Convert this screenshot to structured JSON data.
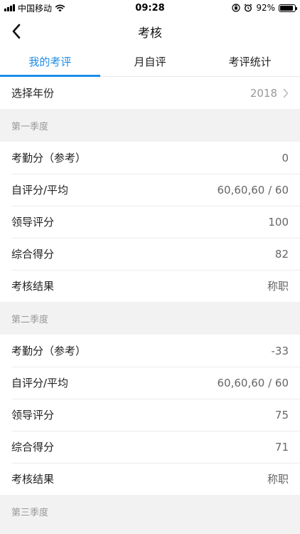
{
  "status_bar": {
    "carrier": "中国移动",
    "time": "09:28",
    "battery": "92%",
    "battery_level": 0.92,
    "icons": [
      "signal-icon",
      "wifi-icon",
      "orientation-lock-icon",
      "alarm-icon",
      "battery-icon"
    ]
  },
  "nav": {
    "title": "考核",
    "back_icon": "chevron-left-icon"
  },
  "tabs": [
    {
      "label": "我的考评",
      "active": true
    },
    {
      "label": "月自评",
      "active": false
    },
    {
      "label": "考评统计",
      "active": false
    }
  ],
  "year_selector": {
    "label": "选择年份",
    "value": "2018",
    "icon": "chevron-right-icon"
  },
  "sections": [
    {
      "title": "第一季度",
      "rows": [
        {
          "label": "考勤分（参考）",
          "value": "0"
        },
        {
          "label": "自评分/平均",
          "value": "60,60,60 / 60"
        },
        {
          "label": "领导评分",
          "value": "100"
        },
        {
          "label": "综合得分",
          "value": "82"
        },
        {
          "label": "考核结果",
          "value": "称职"
        }
      ]
    },
    {
      "title": "第二季度",
      "rows": [
        {
          "label": "考勤分（参考）",
          "value": "-33"
        },
        {
          "label": "自评分/平均",
          "value": "60,60,60 / 60"
        },
        {
          "label": "领导评分",
          "value": "75"
        },
        {
          "label": "综合得分",
          "value": "71"
        },
        {
          "label": "考核结果",
          "value": "称职"
        }
      ]
    },
    {
      "title": "第三季度",
      "rows": []
    }
  ],
  "colors": {
    "accent": "#1e8ce6",
    "background": "#f2f2f2",
    "muted": "#999999"
  }
}
